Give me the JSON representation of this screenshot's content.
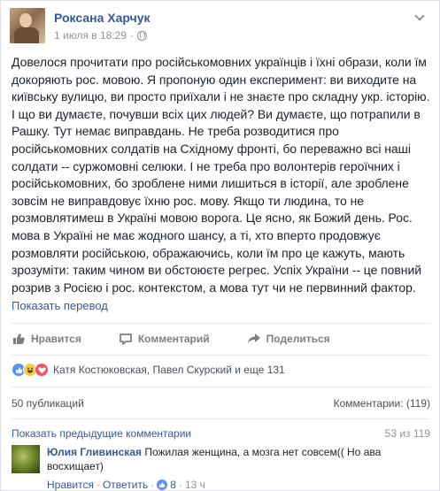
{
  "post": {
    "author": "Роксана Харчук",
    "date": "1 июля в 18:29",
    "privacy_dot": "·",
    "text": "Довелося прочитати про російськомовних українців і їхні образи, коли їм докоряють рос. мовою. Я пропоную один експеримент: ви виходите на київську вулицю, ви просто приїхали і не знаєте про складну укр. історію. І що ви думаєте, почувши всіх цих людей? Ви думаєте, що потрапили в Рашку. Тут немає виправдань. Не треба розводитися про російськомовних солдатів на Східному фронті, бо переважно всі наші солдати -- суржомовні селюки. І не треба про волонтерів героїчних і російськомовних, бо зроблене ними лишиться в історії, але зроблене зовсім не виправдовує їхню рос. мову. Якщо ти людина, то не розмовлятимеш в Україні мовою ворога. Це ясно, як Божий день. Рос. мова в Україні не має жодного шансу, а ті, хто вперто продовжує розмовляти російською, ображаючись, коли їм про це кажуть, мають зрозуміти: таким чином ви обстоюєте регрес. Успіх України -- це повний розрив з Росією і рос. контекстом, а мова тут чи не первинний фактор.",
    "translate_link": "Показать перевод"
  },
  "actions": {
    "like": "Нравится",
    "comment": "Комментарий",
    "share": "Поделиться"
  },
  "reactions": {
    "names": "Катя Костюковская, Павел Скурский и еще 131"
  },
  "stats": {
    "shares": "50 публикаций",
    "comments": "Комментарии: (119)"
  },
  "comments": {
    "previous_link": "Показать предыдущие комментарии",
    "count": "53 из 119",
    "items": [
      {
        "author": "Юлия Гливинская",
        "text": "Пожилая женщина, а мозга нет совсем(( Но ава восхищает)",
        "like_link": "Нравится",
        "reply_link": "Ответить",
        "likes": "8",
        "time": "13 ч",
        "dot": "·"
      }
    ]
  },
  "colors": {
    "link": "#365899",
    "muted": "#90949c",
    "like_blue": "#5890ff"
  }
}
